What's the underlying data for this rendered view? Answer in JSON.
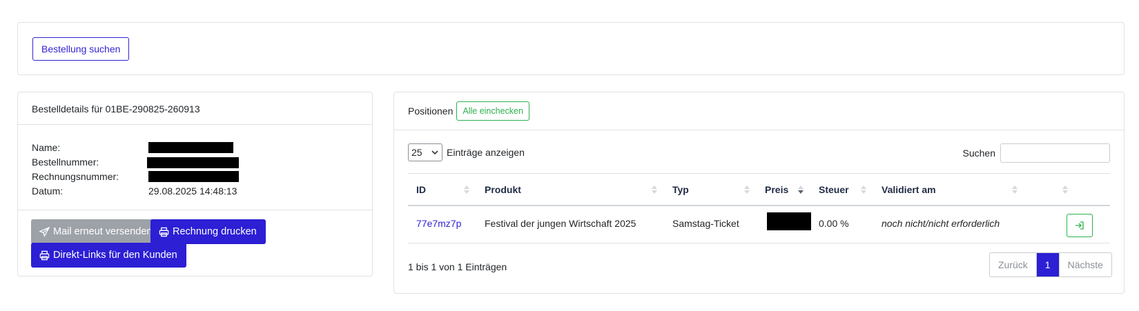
{
  "search_card": {
    "button_label": "Bestellung suchen"
  },
  "details": {
    "title": "Bestelldetails für 01BE-290825-260913",
    "fields": [
      {
        "label": "Name:",
        "value": ""
      },
      {
        "label": "Bestellnummer:",
        "value": ""
      },
      {
        "label": "Rechnungsnummer:",
        "value": ""
      },
      {
        "label": "Datum:",
        "value": "29.08.2025 14:48:13"
      }
    ],
    "buttons": {
      "resend_mail": "Mail erneut versenden",
      "print_invoice": "Rechnung drucken",
      "direct_links": "Direkt-Links für den Kunden"
    }
  },
  "positions": {
    "title": "Positionen",
    "checkin_all": "Alle einchecken",
    "length_value": "25",
    "length_label": "Einträge anzeigen",
    "search_label": "Suchen",
    "columns": [
      "ID",
      "Produkt",
      "Typ",
      "Preis",
      "Steuer",
      "Validiert am"
    ],
    "rows": [
      {
        "id": "77e7mz7p",
        "produkt": "Festival der jungen Wirtschaft 2025",
        "typ": "Samstag-Ticket",
        "preis": "",
        "steuer": "0.00 %",
        "validiert": "noch nicht/nicht erforderlich"
      }
    ],
    "info": "1 bis 1 von 1 Einträgen",
    "pager": {
      "prev": "Zurück",
      "current": "1",
      "next": "Nächste"
    }
  },
  "colors": {
    "primary": "#2c1fd4",
    "success": "#2bb24c",
    "secondary": "#9da1a8"
  }
}
